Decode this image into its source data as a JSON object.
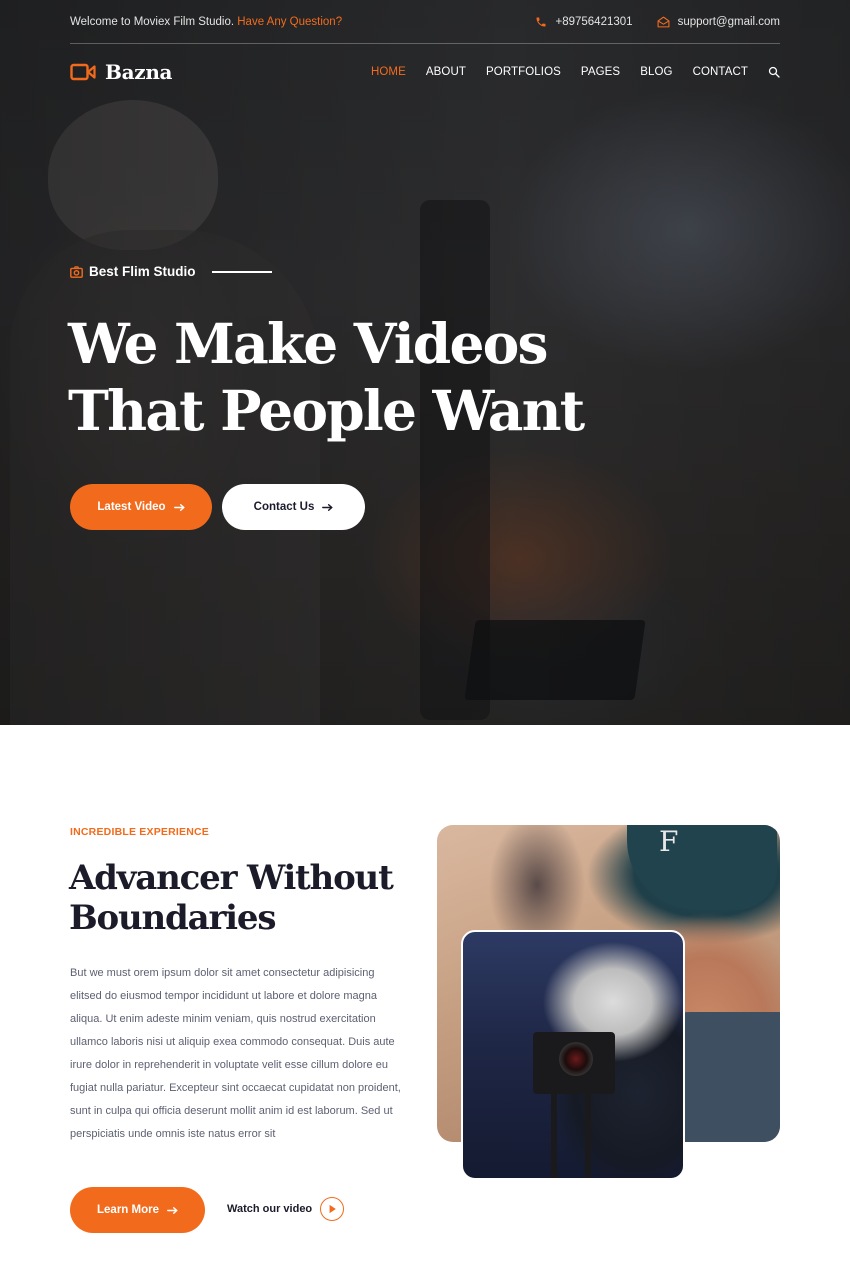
{
  "colors": {
    "accent": "#f26b1d",
    "dark": "#1b1b2a",
    "body_text": "#5d6072"
  },
  "topbar": {
    "welcome": "Welcome to Moviex Film Studio.",
    "question": "Have Any Question?",
    "phone": "+89756421301",
    "email": "support@gmail.com"
  },
  "nav": {
    "logo": "Bazna",
    "items": [
      "HOME",
      "ABOUT",
      "PORTFOLIOS",
      "PAGES",
      "BLOG",
      "CONTACT"
    ],
    "active": "HOME"
  },
  "hero": {
    "tagline": "Best Flim Studio",
    "title_line1": "We Make Videos",
    "title_line2": "That People Want",
    "btn_primary": "Latest Video",
    "btn_secondary": "Contact Us"
  },
  "about": {
    "eyebrow": "INCREDIBLE EXPERIENCE",
    "title_line1": "Advancer Without",
    "title_line2": "Boundaries",
    "paragraph_lines": [
      "But we must orem ipsum dolor sit amet consectetur adipisicing",
      "elitsed do eiusmod tempor incididunt ut labore et dolore magna",
      "aliqua. Ut enim adeste minim veniam, quis nostrud exercitation",
      "ullamco laboris nisi ut aliquip exea commodo consequat. Duis aute",
      "irure dolor in reprehenderit in voluptate velit esse cillum dolore eu",
      "fugiat nulla pariatur. Excepteur sint occaecat cupidatat non proident,",
      "sunt in culpa qui officia deserunt mollit anim id est laborum. Sed ut",
      "perspiciatis unde omnis iste natus error sit"
    ],
    "btn_learn": "Learn More",
    "watch_label": "Watch our video",
    "cap_letter": "F"
  },
  "icons": {
    "phone": "phone-icon",
    "email": "envelope-icon",
    "logo": "video-camera-icon",
    "search": "search-icon",
    "tagline": "camera-icon",
    "arrow": "arrow-right-icon",
    "play": "play-icon"
  }
}
